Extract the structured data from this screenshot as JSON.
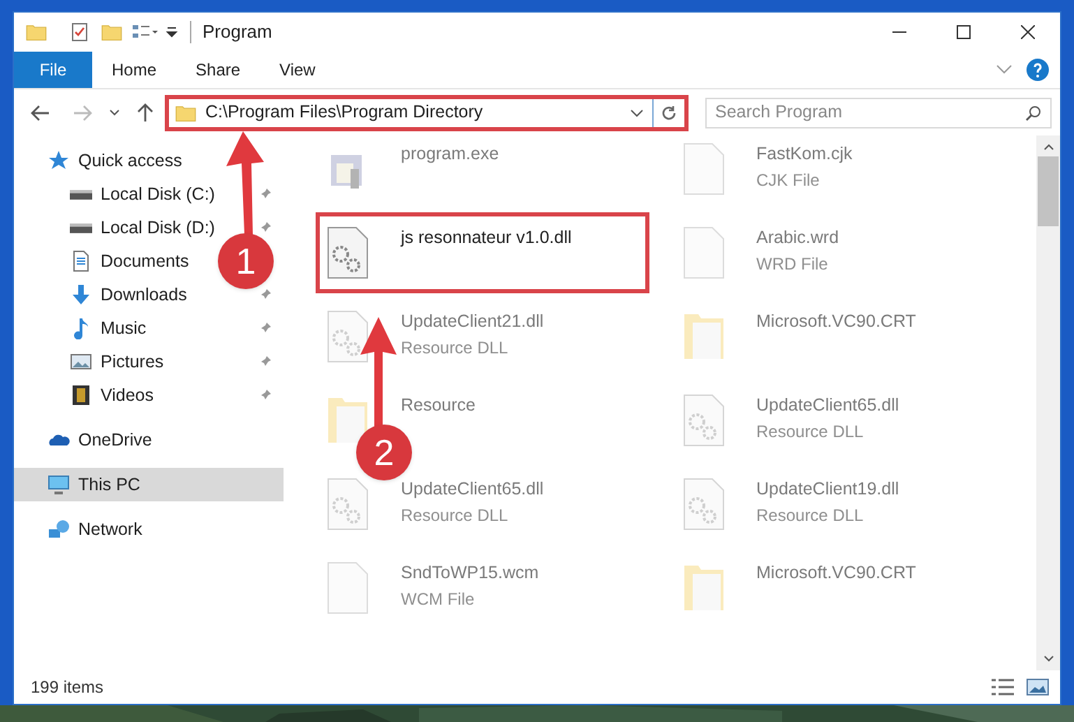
{
  "window": {
    "title": "Program"
  },
  "ribbon_tabs": [
    {
      "label": "File",
      "selected": true
    },
    {
      "label": "Home",
      "selected": false
    },
    {
      "label": "Share",
      "selected": false
    },
    {
      "label": "View",
      "selected": false
    }
  ],
  "address": {
    "path": "C:\\Program Files\\Program Directory"
  },
  "search": {
    "placeholder": "Search Program"
  },
  "sidebar": {
    "items": [
      {
        "label": "Quick access",
        "kind": "star",
        "pinned": false,
        "selected": false,
        "children": [
          {
            "label": "Local Disk (C:)",
            "kind": "disk",
            "pinned": true,
            "selected": false
          },
          {
            "label": "Local Disk (D:)",
            "kind": "disk",
            "pinned": true,
            "selected": false
          },
          {
            "label": "Documents",
            "kind": "documents",
            "pinned": false,
            "selected": false
          },
          {
            "label": "Downloads",
            "kind": "downloads",
            "pinned": true,
            "selected": false
          },
          {
            "label": "Music",
            "kind": "music",
            "pinned": true,
            "selected": false
          },
          {
            "label": "Pictures",
            "kind": "pictures",
            "pinned": true,
            "selected": false
          },
          {
            "label": "Videos",
            "kind": "videos",
            "pinned": true,
            "selected": false
          }
        ]
      },
      {
        "label": "OneDrive",
        "kind": "cloud",
        "pinned": false,
        "selected": false
      },
      {
        "label": "This PC",
        "kind": "pc",
        "pinned": false,
        "selected": true
      },
      {
        "label": "Network",
        "kind": "network",
        "pinned": false,
        "selected": false
      }
    ]
  },
  "files": [
    {
      "name": "program.exe",
      "kind": "app",
      "highlighted": false
    },
    {
      "name": "FastKom.cjk",
      "type": "CJK File",
      "kind": "file",
      "highlighted": false
    },
    {
      "name": "js resonnateur v1.0.dll",
      "kind": "dll",
      "highlighted": true
    },
    {
      "name": "Arabic.wrd",
      "type": "WRD File",
      "kind": "file",
      "highlighted": false
    },
    {
      "name": "UpdateClient21.dll",
      "type": "Resource DLL",
      "kind": "dll",
      "highlighted": false
    },
    {
      "name": "Microsoft.VC90.CRT",
      "kind": "folder",
      "highlighted": false
    },
    {
      "name": "Resource",
      "kind": "folder",
      "highlighted": false
    },
    {
      "name": "UpdateClient65.dll",
      "type": "Resource DLL",
      "kind": "dll",
      "highlighted": false
    },
    {
      "name": "UpdateClient65.dll",
      "type": "Resource DLL",
      "kind": "dll",
      "highlighted": false
    },
    {
      "name": "UpdateClient19.dll",
      "type": "Resource DLL",
      "kind": "dll",
      "highlighted": false
    },
    {
      "name": "SndToWP15.wcm",
      "type": "WCM File",
      "kind": "file",
      "highlighted": false
    },
    {
      "name": "Microsoft.VC90.CRT",
      "kind": "folder",
      "highlighted": false
    }
  ],
  "status_bar": {
    "count": "199 items"
  },
  "annotations": [
    {
      "number": "1"
    },
    {
      "number": "2"
    }
  ]
}
